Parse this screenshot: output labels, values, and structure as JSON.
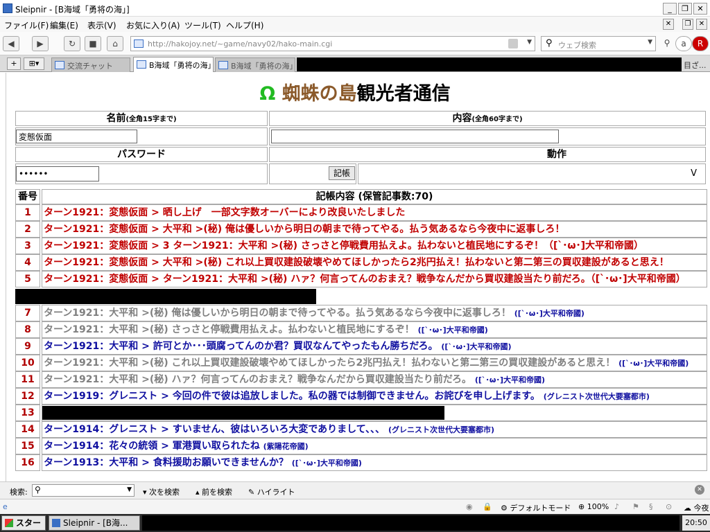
{
  "window": {
    "title": "Sleipnir - [B海域「勇将の海」]"
  },
  "menu": [
    "ファイル(F)",
    "編集(E)",
    "表示(V)",
    "お気に入り(A)",
    "ツール(T)",
    "ヘルプ(H)"
  ],
  "address": {
    "url": "http://hakojoy.net/~game/navy02/hako-main.cgi"
  },
  "search": {
    "placeholder": "ウェブ検索"
  },
  "tabs": [
    {
      "label": "交流チャット",
      "active": false
    },
    {
      "label": "B海域「勇将の海」",
      "active": true
    },
    {
      "label": "B海域「勇将の海」",
      "active": false
    }
  ],
  "tab_more": "目ざ...",
  "page": {
    "title_omega": "Ω",
    "title_island": "蜘蛛の島",
    "title_rest": "観光者通信",
    "name_label": "名前",
    "name_note": "(全角15字まで)",
    "content_label": "内容",
    "content_note": "(全角60字まで)",
    "name_value": "変態仮面",
    "password_label": "パスワード",
    "action_label": "動作",
    "password_value": "••••••",
    "submit_label": "記帳",
    "action_right": "V",
    "col_num": "番号",
    "col_body": "記帳内容 (保管記事数:70)"
  },
  "entries": [
    {
      "num": "1",
      "text": "ターン1921：変態仮面 > 晒し上げ　一部文字数オーバーにより改良いたしました",
      "sig": "",
      "color": "#c00000"
    },
    {
      "num": "2",
      "text": "ターン1921：変態仮面 > 大平和 >(秘) 俺は優しいから明日の朝まで待ってやる。払う気あるなら今夜中に返事しろ！",
      "sig": "",
      "color": "#c00000"
    },
    {
      "num": "3",
      "text": "ターン1921：変態仮面 > 3 ターン1921：大平和 >(秘) さっさと停戦費用払えよ。払わないと植民地にするぞ！（[`･ω･]大平和帝國）",
      "sig": "",
      "color": "#c00000"
    },
    {
      "num": "4",
      "text": "ターン1921：変態仮面 > 大平和 >(秘) これ以上買収建設破壊やめてほしかったら2兆円払え！払わないと第二第三の買収建設があると思え！",
      "sig": "",
      "color": "#c00000"
    },
    {
      "num": "5",
      "text": "ターン1921：変態仮面 > ターン1921：大平和 >(秘) ハァ？何言ってんのおまえ？戦争なんだから買収建設当たり前だろ。（[`･ω･]大平和帝國）",
      "sig": "",
      "color": "#c00000"
    },
    {
      "num": "7",
      "text": "ターン1921：大平和 >(秘) 俺は優しいから明日の朝まで待ってやる。払う気あるなら今夜中に返事しろ！",
      "sig": "([`･ω･]大平和帝國)",
      "color": "#808080"
    },
    {
      "num": "8",
      "text": "ターン1921：大平和 >(秘) さっさと停戦費用払えよ。払わないと植民地にするぞ！",
      "sig": "([`･ω･]大平和帝國)",
      "color": "#808080"
    },
    {
      "num": "9",
      "text": "ターン1921：大平和 > 許可とか･･･頭腐ってんのか君？買収なんてやったもん勝ちだろ。",
      "sig": "([`･ω･]大平和帝國)",
      "color": "#1010a0"
    },
    {
      "num": "10",
      "text": "ターン1921：大平和 >(秘) これ以上買収建設破壊やめてほしかったら2兆円払え！払わないと第二第三の買収建設があると思え！",
      "sig": "([`･ω･]大平和帝國)",
      "color": "#808080"
    },
    {
      "num": "11",
      "text": "ターン1921：大平和 >(秘) ハァ？何言ってんのおまえ？戦争なんだから買収建設当たり前だろ。",
      "sig": "([`･ω･]大平和帝國)",
      "color": "#808080"
    },
    {
      "num": "12",
      "text": "ターン1919：グレニスト > 今回の件で彼は追放しました。私の器では制御できません。お詫びを申し上げます。",
      "sig": "(グレニスト次世代大要塞都市)",
      "color": "#1010a0"
    },
    {
      "num": "13",
      "text": "",
      "sig": "",
      "color": "#000"
    },
    {
      "num": "14",
      "text": "ターン1914：グレニスト > すいません、彼はいろいろ大変でありまして、、、",
      "sig": "(グレニスト次世代大要塞都市)",
      "color": "#1010a0"
    },
    {
      "num": "15",
      "text": "ターン1914：花々の統領 > 軍港買い取られたね",
      "sig": "(紫陽花帝國)",
      "color": "#1010a0"
    },
    {
      "num": "16",
      "text": "ターン1913：大平和 > 食料援助お願いできませんか？",
      "sig": "([`･ω･]大平和帝國)",
      "color": "#1010a0"
    }
  ],
  "findbar": {
    "label": "検索:",
    "next": "次を検索",
    "prev": "前を検索",
    "highlight": "ハイライト"
  },
  "status": {
    "mode": "デフォルトモード",
    "zoom": "100%",
    "weather": "今夜"
  },
  "taskbar": {
    "start": "スタート",
    "task": "Sleipnir - [B海...",
    "clock": "20:50"
  }
}
